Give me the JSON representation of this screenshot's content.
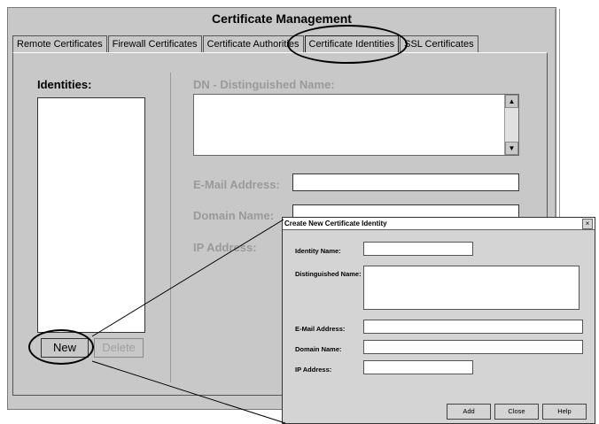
{
  "window": {
    "title": "Certificate Management"
  },
  "tabs": [
    {
      "label": "Remote Certificates"
    },
    {
      "label": "Firewall Certificates"
    },
    {
      "label": "Certificate Authorities"
    },
    {
      "label": "Certificate Identities",
      "active": true
    },
    {
      "label": "SSL Certificates"
    }
  ],
  "identities": {
    "label": "Identities:",
    "new_label": "New",
    "delete_label": "Delete"
  },
  "details": {
    "dn_label": "DN - Distinguished Name:",
    "email_label": "E-Mail Address:",
    "domain_label": "Domain Name:",
    "ip_label": "IP Address:"
  },
  "dialog": {
    "title": "Create New Certificate Identity",
    "identity_name_label": "Identity Name:",
    "distinguished_name_label": "Distinguished Name:",
    "email_label": "E-Mail Address:",
    "domain_label": "Domain Name:",
    "ip_label": "IP Address:",
    "add_label": "Add",
    "close_label": "Close",
    "help_label": "Help"
  }
}
